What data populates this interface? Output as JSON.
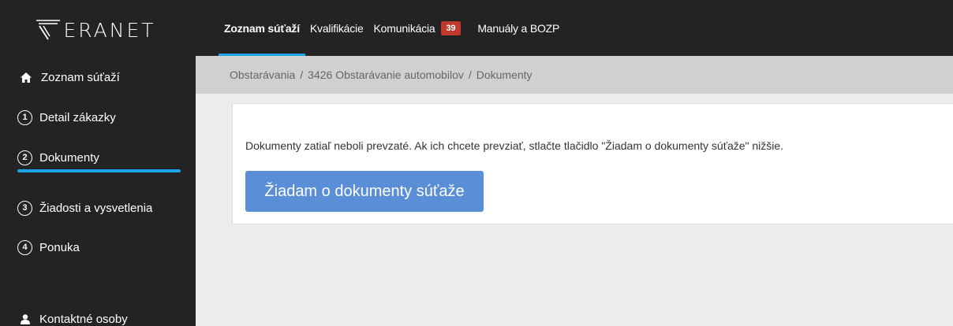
{
  "logo": {
    "text": "ERANET"
  },
  "sidebar": {
    "items": [
      {
        "label": "Zoznam súťaží",
        "icon": "home-icon"
      },
      {
        "num": "1",
        "label": "Detail zákazky"
      },
      {
        "num": "2",
        "label": "Dokumenty",
        "active": true
      },
      {
        "num": "3",
        "label": "Žiadosti a vysvetlenia"
      },
      {
        "num": "4",
        "label": "Ponuka"
      },
      {
        "label": "Kontaktné osoby",
        "icon": "user-icon"
      }
    ]
  },
  "topnav": {
    "tabs": [
      {
        "label": "Zoznam súťaží",
        "active": true
      },
      {
        "label": "Kvalifikácie"
      },
      {
        "label": "Komunikácia",
        "badge": "39"
      },
      {
        "label": "Manuály a BOZP"
      }
    ]
  },
  "breadcrumb": {
    "items": [
      "Obstarávania",
      "3426 Obstarávanie automobilov",
      "Dokumenty"
    ],
    "separator": "/"
  },
  "main": {
    "message": "Dokumenty zatiaľ neboli prevzaté. Ak ich chcete prevziať, stlačte tlačidlo \"Žiadam o dokumenty súťaže\" nižšie.",
    "button_label": "Žiadam o dokumenty súťaže"
  },
  "colors": {
    "dark": "#232323",
    "accent": "#1aa3e8",
    "button": "#5a8fd8",
    "badge": "#c0392b"
  }
}
